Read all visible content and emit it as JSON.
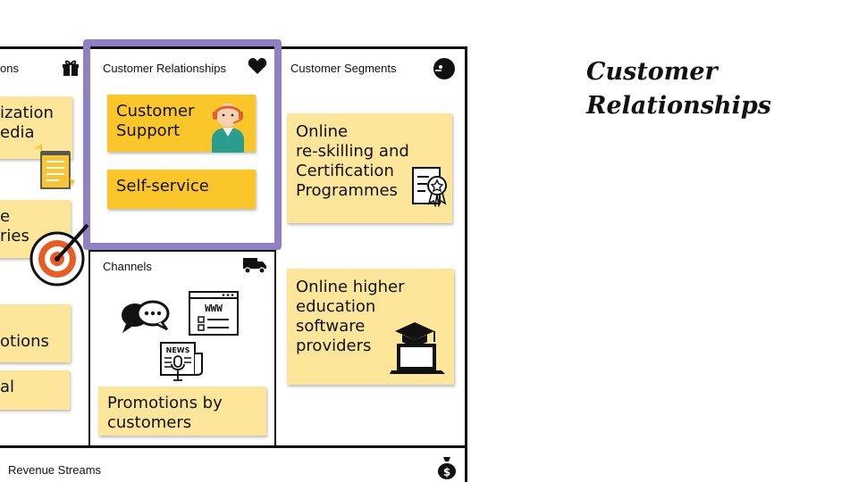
{
  "canvas": {
    "partners_header": "ons",
    "relationships_header": "Customer Relationships",
    "segments_header": "Customer Segments",
    "channels_header": "Channels",
    "revenue_header": "Revenue Streams",
    "notes": {
      "left_note_1": "ization\nedia",
      "left_note_2": "e\nries",
      "left_note_3": "otions",
      "left_note_4": "al",
      "customer_support": "Customer\nSupport",
      "self_service": "Self-service",
      "online_reskilling": "Online\nre-skilling and\nCertification\nProgrammes",
      "online_higher_ed": "Online higher\neducation\nsoftware\nproviders",
      "promotions": "Promotions by\ncustomers"
    },
    "icons": {
      "partners": "gift-icon",
      "relationships": "heart-icon",
      "segments": "face-icon",
      "channels": "truck-icon",
      "revenue": "money-bag-icon",
      "support": "headset-agent-icon",
      "certificate": "certificate-icon",
      "graduation": "graduation-laptop-icon",
      "chat": "chat-bubble-icon",
      "web": "browser-www-icon",
      "news": "newspaper-mic-icon",
      "target": "target-icon",
      "notepad": "notepad-icon"
    },
    "colors": {
      "note": "#fde59a",
      "note_gold": "#fbc62a",
      "highlight": "#8f7fc4"
    }
  },
  "side_title": "Customer\nRelationships"
}
